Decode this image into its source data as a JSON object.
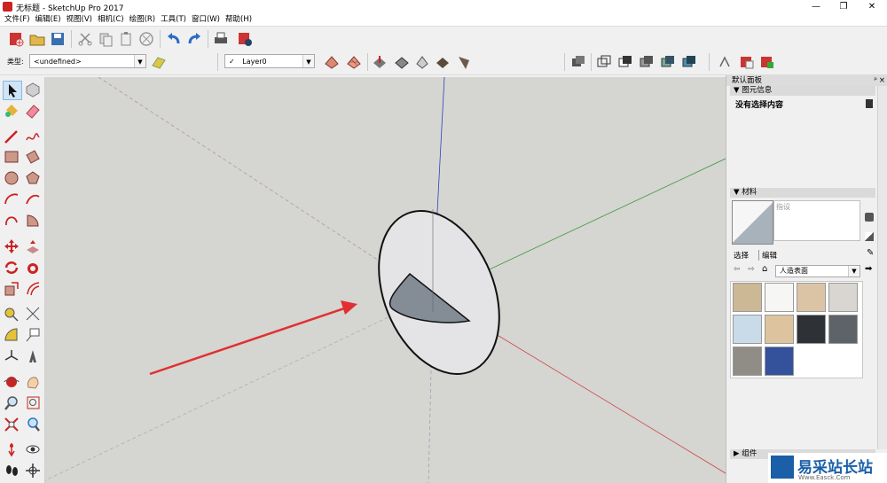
{
  "window": {
    "title": "无标题 - SketchUp Pro 2017"
  },
  "menu": [
    "文件(F)",
    "编辑(E)",
    "视图(V)",
    "相机(C)",
    "绘图(R)",
    "工具(T)",
    "窗口(W)",
    "帮助(H)"
  ],
  "entity_type": {
    "label": "类型:",
    "value": "<undefined>"
  },
  "layer": {
    "check": "✓",
    "value": "Layer0"
  },
  "panel": {
    "tray_title": "默认面板",
    "entity_info": {
      "header": "图元信息",
      "content": "没有选择内容"
    },
    "materials": {
      "header": "材料",
      "name_placeholder": "指设",
      "tabs": [
        "选择",
        "编辑"
      ],
      "library": "人造表面",
      "swatch_colors": [
        "#cdb896",
        "#f6f6f4",
        "#dbc4a6",
        "#d9d6d2",
        "#c9dbe8",
        "#ddc49f",
        "#2e3136",
        "#5d6368",
        "#8f8d85",
        "#34519c"
      ]
    },
    "components": {
      "header": "组件"
    }
  },
  "watermark": {
    "text": "易采站长站",
    "subtext": "Www.Easck.Com"
  },
  "colors": {
    "red_axis": "#d04040",
    "green_axis": "#3a9a3a",
    "blue_axis": "#3040c0",
    "canvas_bg": "#d5d5d2",
    "arrow": "#e03030"
  }
}
